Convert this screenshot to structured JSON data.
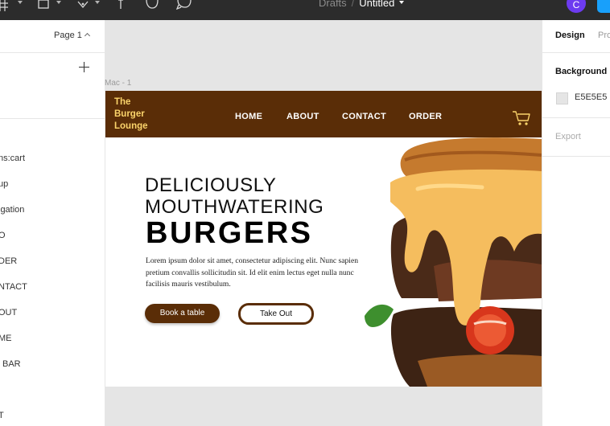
{
  "toolbar": {
    "project": "Drafts",
    "separator": "/",
    "file_name": "Untitled",
    "avatar_initial": "C"
  },
  "layers_panel": {
    "page_selector": "Page 1",
    "layers": [
      "ns:cart",
      "up",
      "igation",
      "O",
      "DER",
      "NTACT",
      "OUT",
      "ME",
      "BAR",
      "T"
    ]
  },
  "canvas": {
    "frame_label": "Mac - 1",
    "site": {
      "brand_lines": [
        "The",
        "Burger",
        "Lounge"
      ],
      "nav": [
        "HOME",
        "ABOUT",
        "CONTACT",
        "ORDER"
      ],
      "headline_1": "DELICIOUSLY",
      "headline_2": "MOUTHWATERING",
      "headline_3": "BURGERS",
      "body": "Lorem ipsum dolor sit amet, consectetur adipiscing elit. Nunc sapien pretium convallis sollicitudin sit. Id elit enim lectus eget nulla nunc facilisis mauris vestibulum.",
      "btn_primary": "Book a table",
      "btn_secondary": "Take Out"
    }
  },
  "design_panel": {
    "tab_design": "Design",
    "tab_prototype": "Pro",
    "background_title": "Background",
    "background_hex": "E5E5E5",
    "export_title": "Export"
  },
  "colors": {
    "brand_brown": "#5a2d07",
    "brand_yellow": "#fbd46b",
    "canvas_bg": "#e5e5e5",
    "figma_blue": "#18a0fb"
  }
}
